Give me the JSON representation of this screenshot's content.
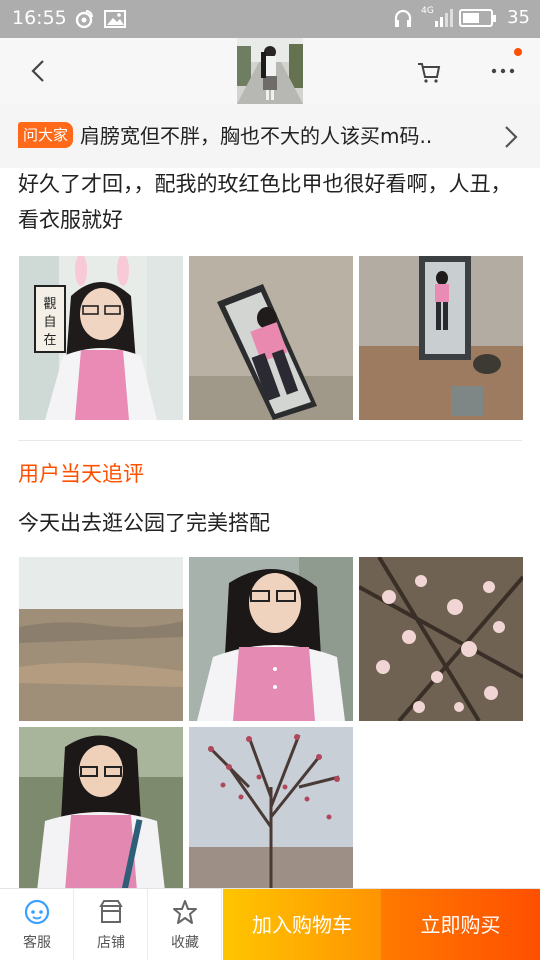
{
  "status_bar": {
    "time": "16:55",
    "battery": "35",
    "network": "4G"
  },
  "nav": {
    "icons": [
      "back-icon",
      "product-thumbnail",
      "cart-icon",
      "more-icon"
    ]
  },
  "ask": {
    "badge": "问大家",
    "question": "肩膀宽但不胖，胸也不大的人该买m码.."
  },
  "review": {
    "text": "好久了才回，，配我的玫红色比甲也很好看啊，人丑，看衣服就好",
    "photo_count": 3
  },
  "followup": {
    "title": "用户当天追评",
    "text": "今天出去逛公园了完美搭配",
    "photo_count": 5
  },
  "thumb_sign": "觀自在",
  "bottom_bar": {
    "service": "客服",
    "shop": "店铺",
    "favorite": "收藏",
    "add_to_cart": "加入购物车",
    "buy_now": "立即购买"
  },
  "colors": {
    "accent": "#ff5000",
    "cart_button": "#ffa000",
    "buy_button": "#ff5a00",
    "status_bar": "#adadad"
  }
}
